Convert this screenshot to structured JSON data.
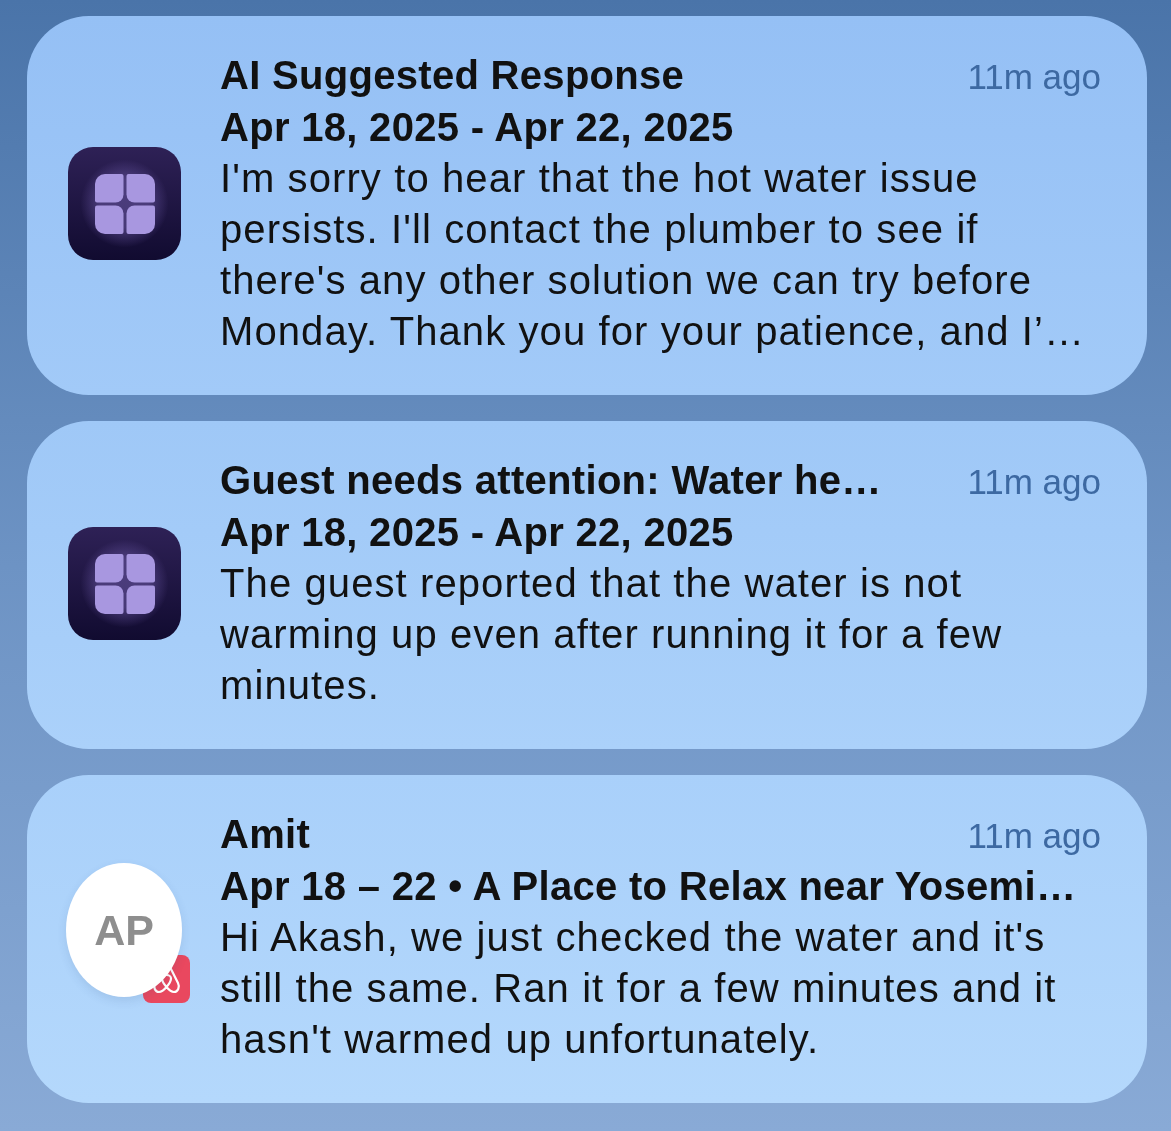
{
  "notifications": [
    {
      "kind": "app",
      "title": "AI Suggested Response",
      "time": "11m ago",
      "subtitle": "Apr 18, 2025 - Apr 22, 2025",
      "body": "I'm sorry to hear that the hot water issue persists. I'll contact the plumber to see if there's any other solution we can try before Monday. Thank you for your patience, and I’…"
    },
    {
      "kind": "app",
      "title": "Guest needs attention: Water he…",
      "time": "11m ago",
      "subtitle": "Apr 18, 2025 - Apr 22, 2025",
      "body": "The guest reported that the water is not warming up even after running it for a few minutes."
    },
    {
      "kind": "contact",
      "avatar": "AP",
      "title": "Amit",
      "time": "11m ago",
      "subtitle": "Apr 18 – 22 • A Place to Relax near Yosemi…",
      "body": "Hi Akash, we just checked the water and it's still the same. Ran it for a few minutes and it hasn't warmed up unfortunately."
    }
  ]
}
